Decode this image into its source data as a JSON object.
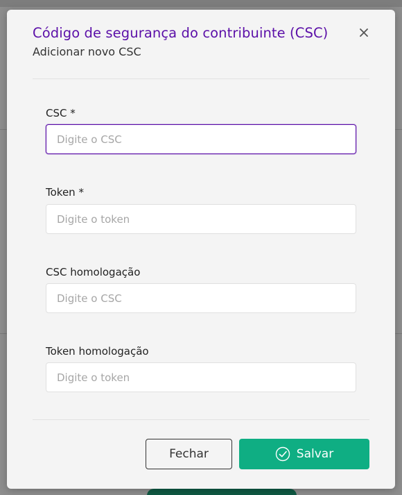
{
  "modal": {
    "title": "Código de segurança do contribuinte (CSC)",
    "subtitle": "Adicionar novo CSC"
  },
  "fields": [
    {
      "label": "CSC *",
      "placeholder": "Digite o CSC",
      "value": ""
    },
    {
      "label": "Token *",
      "placeholder": "Digite o token",
      "value": ""
    },
    {
      "label": "CSC homologação",
      "placeholder": "Digite o CSC",
      "value": ""
    },
    {
      "label": "Token homologação",
      "placeholder": "Digite o token",
      "value": ""
    }
  ],
  "buttons": {
    "close_label": "Fechar",
    "save_label": "Salvar"
  },
  "colors": {
    "title": "#5b0fa8",
    "focus_border": "#5b0fa8",
    "save_button": "#0fae83"
  },
  "icons": {
    "close": "close-icon",
    "save": "check-circle-icon"
  }
}
